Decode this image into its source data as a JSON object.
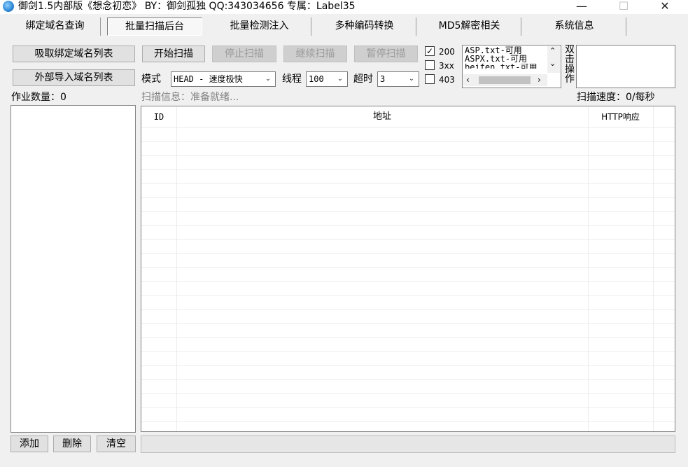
{
  "window": {
    "title": "御剑1.5内部版《想念初恋》 BY：御剑孤独 QQ:343034656    专属：Label35",
    "minimize": "—",
    "maximize": "☐",
    "close": "✕"
  },
  "tabs": [
    {
      "label": "绑定域名查询"
    },
    {
      "label": "批量扫描后台"
    },
    {
      "label": "批量检测注入"
    },
    {
      "label": "多种编码转换"
    },
    {
      "label": "MD5解密相关"
    },
    {
      "label": "系统信息"
    }
  ],
  "left_panel": {
    "fetch_button": "吸取绑定域名列表",
    "import_button": "外部导入域名列表",
    "job_count_label": "作业数量：0",
    "add_button": "添加",
    "delete_button": "删除",
    "clear_button": "清空"
  },
  "toolbar": {
    "start_button": "开始扫描",
    "stop_button": "停止扫描",
    "continue_button": "继续扫描",
    "pause_button": "暂停扫描",
    "mode_label": "模式",
    "mode_value": "HEAD - 速度极快",
    "threads_label": "线程",
    "threads_value": "100",
    "timeout_label": "超时",
    "timeout_value": "3",
    "scan_info": "扫描信息：准备就绪...",
    "scan_speed": "扫描速度：0/每秒"
  },
  "status_filters": [
    {
      "label": "200",
      "checked": true
    },
    {
      "label": "3xx",
      "checked": false
    },
    {
      "label": "403",
      "checked": false
    }
  ],
  "dictionaries": {
    "items": [
      "ASP.txt-可用",
      "ASPX.txt-可用",
      "beifen.txt-可用"
    ],
    "side_label": "双击操作"
  },
  "results_table": {
    "columns": [
      "ID",
      "地址",
      "HTTP响应"
    ],
    "rows": []
  }
}
